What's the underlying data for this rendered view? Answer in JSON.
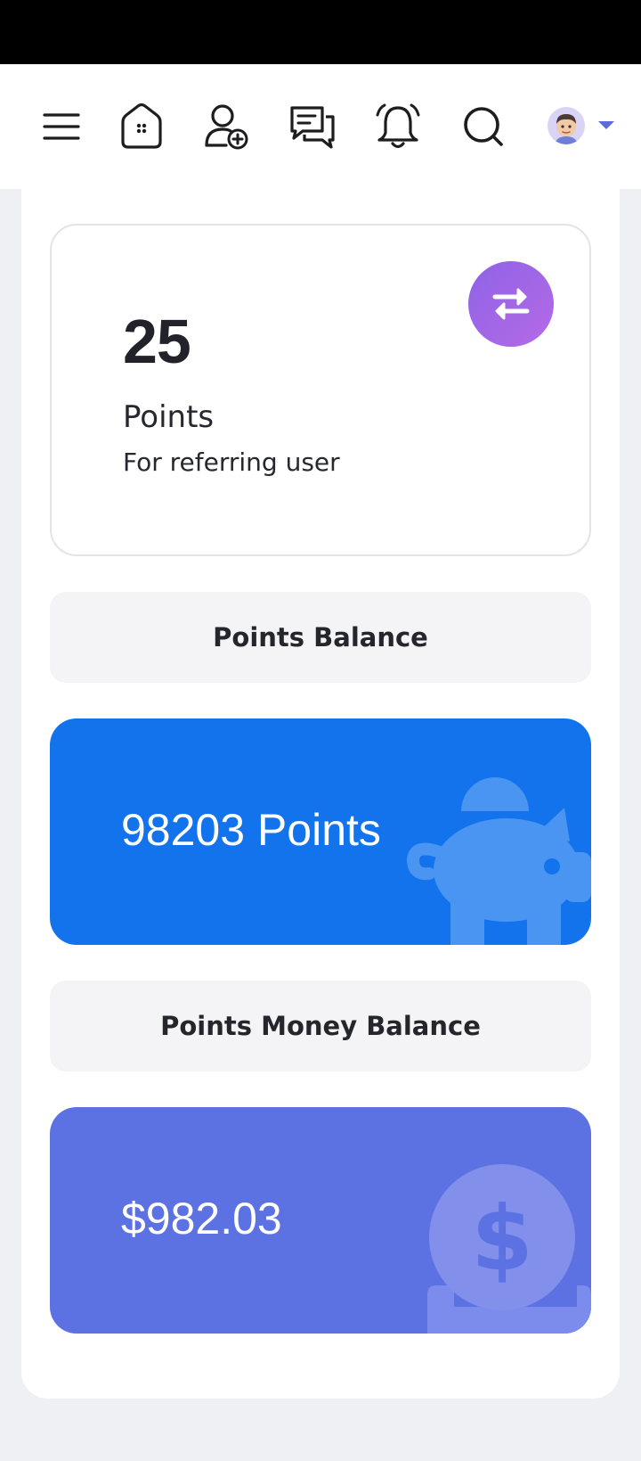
{
  "nav": {
    "icons": [
      "menu-icon",
      "home-icon",
      "add-user-icon",
      "messages-icon",
      "bell-icon",
      "search-icon"
    ],
    "avatar": "user-avatar"
  },
  "referral": {
    "points": "25",
    "label": "Points",
    "description": "For referring user",
    "action_icon": "transfer-icon"
  },
  "points_balance": {
    "header": "Points Balance",
    "value": "98203 Points",
    "decor_icon": "piggy-bank-icon"
  },
  "money_balance": {
    "header": "Points Money Balance",
    "value": "$982.03",
    "decor_icon": "dollar-coin-icon"
  },
  "colors": {
    "primary_blue": "#1273ec",
    "indigo": "#5d72e2",
    "transfer_gradient_start": "#8e63e6",
    "transfer_gradient_end": "#b56ae6"
  }
}
